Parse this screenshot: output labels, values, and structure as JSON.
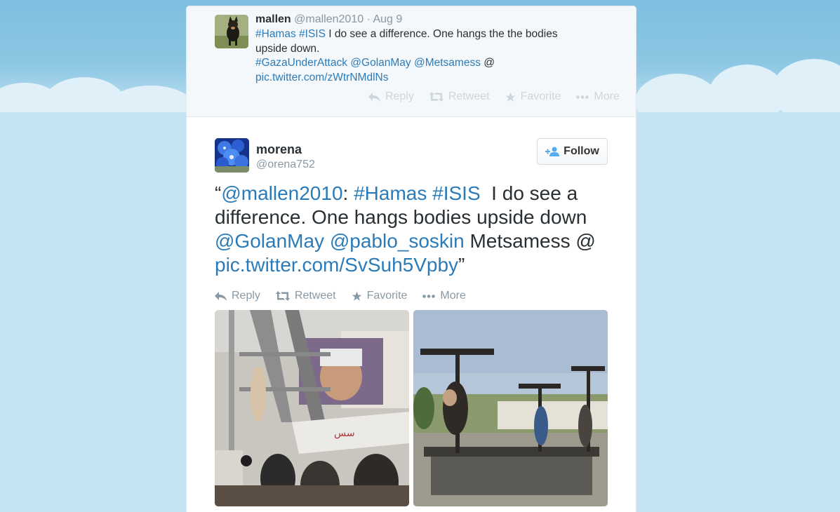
{
  "colors": {
    "link": "#2b7bb9",
    "muted": "#8899a6",
    "text": "#292f33",
    "background_sky": "#a9d4ea"
  },
  "previous_tweet": {
    "name": "mallen",
    "handle": "@mallen2010",
    "date": "· Aug 9",
    "text": {
      "part1_tag1": "#Hamas",
      "part1_tag2": "#ISIS",
      "part1_rest": " I do see a difference. One hangs the the bodies upside down.",
      "line2_tag": "#GazaUnderAttack",
      "line2_mention1": "@GolanMay",
      "line2_mention2": "@Metsamess",
      "line2_at": " @",
      "line3_link": "pic.twitter.com/zWtrNMdlNs"
    },
    "actions": {
      "reply": "Reply",
      "retweet": "Retweet",
      "favorite": "Favorite",
      "more": "More"
    }
  },
  "main_tweet": {
    "name": "morena",
    "handle": "@orena752",
    "follow_label": "Follow",
    "text": {
      "open_quote": "“",
      "mention1": "@mallen2010",
      "colon": ": ",
      "tag1": "#Hamas",
      "tag2": "#ISIS",
      "rest1": "  I do see a difference. One hangs bodies upside down ",
      "mention2": "@GolanMay",
      "mention3": "@pablo_soskin",
      "rest2": " Metsamess @ ",
      "link": "pic.twitter.com/SvSuh5Vpby",
      "close_quote": "”"
    },
    "actions": {
      "reply": "Reply",
      "retweet": "Retweet",
      "favorite": "Favorite",
      "more": "More"
    },
    "media": [
      "photo-left",
      "photo-right"
    ]
  }
}
